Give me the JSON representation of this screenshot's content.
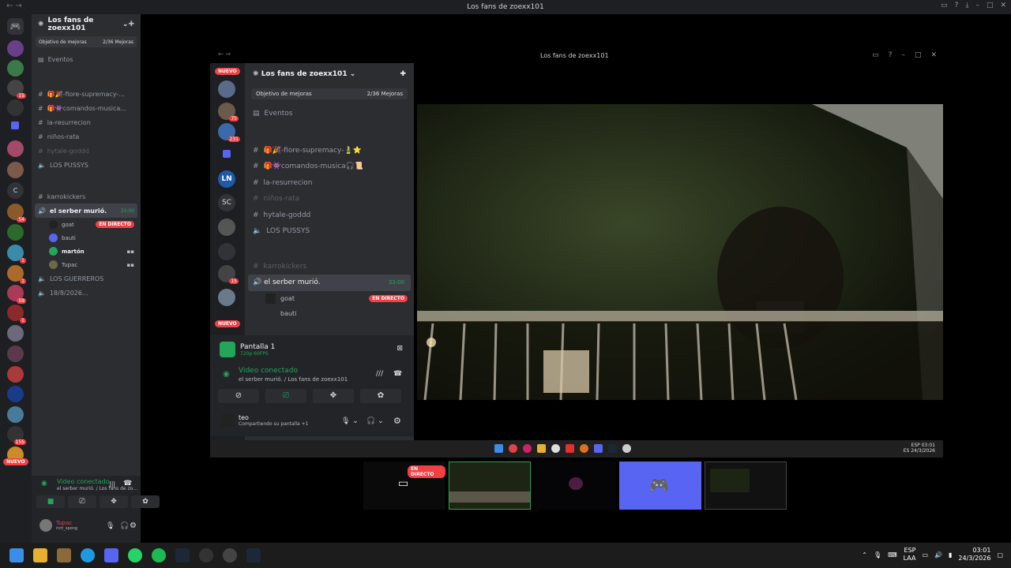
{
  "window": {
    "title": "Los fans de zoexx101"
  },
  "outer_sidebar": {
    "server_name": "Los fans de zoexx101",
    "boost": {
      "label": "Objetivo de mejoras",
      "count": "2/36 Mejoras"
    },
    "events": "Eventos",
    "channels": [
      {
        "name": "🎁🎉-fiore-supremacy-...",
        "muted": false
      },
      {
        "name": "🎁👾comandos-musica...",
        "muted": false
      },
      {
        "name": "la-resurrecion",
        "muted": false
      },
      {
        "name": "niños-rata",
        "muted": false
      },
      {
        "name": "hytale-goddd",
        "muted": true
      },
      {
        "name": "LOS PUSSYS",
        "muted": false
      }
    ],
    "karrokickers": "karrokickers",
    "active_voice": {
      "name": "el serber murió.",
      "time": "33:00"
    },
    "users": [
      {
        "name": "goat",
        "live": "EN DIRECTO"
      },
      {
        "name": "bauti",
        "live": ""
      },
      {
        "name": "martón",
        "live": ""
      },
      {
        "name": "Tupac",
        "live": ""
      }
    ],
    "extra_voice": [
      "LOS GUERREROS",
      "18/8/2026..."
    ],
    "voice_panel": {
      "status": "Video conectado",
      "sub": "el serber murió. / Los fans de zo...",
      "user": "Tupac",
      "user_status": "rich_spong"
    }
  },
  "rail": {
    "nuevo": "NUEVO",
    "letter": "C",
    "badges": [
      "15",
      "54",
      "1",
      "1",
      "59",
      "1",
      "155"
    ]
  },
  "inner": {
    "title": "Los fans de zoexx101",
    "server_name": "Los fans de zoexx101",
    "boost": {
      "label": "Objetivo de mejoras",
      "count": "2/36 Mejoras"
    },
    "events": "Eventos",
    "channels": [
      {
        "name": "🎁🎉-fiore-supremacy-🎍⭐",
        "muted": false
      },
      {
        "name": "🎁👾comandos-musica🎧📜",
        "muted": false
      },
      {
        "name": "la-resurrecion",
        "muted": false
      },
      {
        "name": "niños-rata",
        "muted": true
      },
      {
        "name": "hytale-goddd",
        "muted": false
      },
      {
        "name": "LOS PUSSYS",
        "muted": false
      }
    ],
    "karrokickers": "karrokickers",
    "active_voice": {
      "name": "el serber murió.",
      "time": "33:00"
    },
    "users": [
      {
        "name": "goat",
        "live": "EN DIRECTO"
      },
      {
        "name": "bauti",
        "live": ""
      }
    ],
    "rail_nuevo": "NUEVO",
    "rail_badges": [
      "75",
      "231",
      "15"
    ],
    "rail_letters": [
      "SC",
      "LN"
    ],
    "screen_share": {
      "title": "Pantalla 1",
      "quality": "720p 60FPS"
    },
    "voice_panel": {
      "status": "Video conectado",
      "sub": "el serber murió. / Los fans de zoexx101"
    },
    "me": {
      "name": "teo",
      "status": "Compartiendo su pantalla +1"
    },
    "taskbar": {
      "lang": "ESP",
      "lang2": "ES",
      "time": "03:01",
      "date": "24/3/2026"
    }
  },
  "thumbs": {
    "live": "EN DIRECTO"
  },
  "taskbar": {
    "lang": "ESP",
    "lang2": "LAA",
    "time": "03:01",
    "date": "24/3/2026"
  },
  "colors": {
    "accent": "#5865f2",
    "live": "#f23f43",
    "connected": "#23a55a"
  }
}
